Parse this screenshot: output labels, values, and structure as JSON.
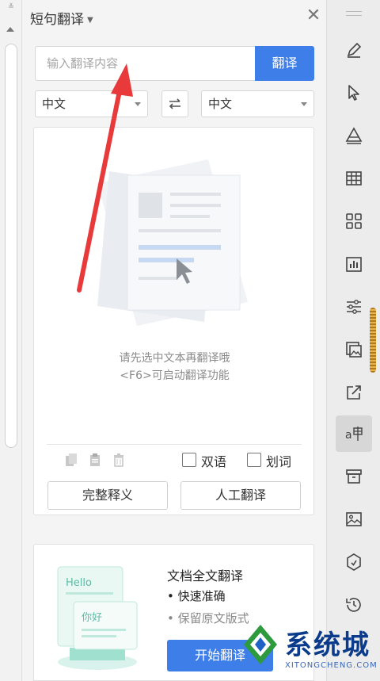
{
  "panel": {
    "title": "短句翻译",
    "close_symbol": "✕"
  },
  "search": {
    "placeholder": "输入翻译内容",
    "value": "",
    "button_label": "翻译"
  },
  "language": {
    "source": "中文",
    "target": "中文",
    "swap_icon": "swap-arrows-icon"
  },
  "result": {
    "hint_line1": "请先选中文本再翻译哦",
    "hint_line2": "<F6>可启动翻译功能",
    "tools": [
      "copy-icon",
      "paste-icon",
      "delete-icon"
    ],
    "options": [
      {
        "label": "双语",
        "checked": false
      },
      {
        "label": "划词",
        "checked": false
      }
    ],
    "buttons": {
      "full_definition": "完整释义",
      "human_translation": "人工翻译"
    }
  },
  "promo": {
    "title": "文档全文翻译",
    "bullet1": "• 快速准确",
    "bullet2": "• 保留原文版式",
    "button_label": "开始翻译",
    "illustration_text1": "Hello",
    "illustration_text2": "你好"
  },
  "toolbar": {
    "items": [
      "pen-icon",
      "pointer-icon",
      "shape-icon",
      "table-icon",
      "apps-grid-icon",
      "bar-chart-icon",
      "settings-sliders-icon",
      "image-gallery-icon",
      "share-icon",
      "translate-icon",
      "archive-icon",
      "picture-icon",
      "shield-icon",
      "history-icon"
    ],
    "active": "translate-icon"
  },
  "watermark": {
    "text": "系统城",
    "sub": "XITONGCHENG.COM"
  },
  "colors": {
    "accent": "#3e7ee8",
    "annotation_arrow": "#e83a3a"
  }
}
